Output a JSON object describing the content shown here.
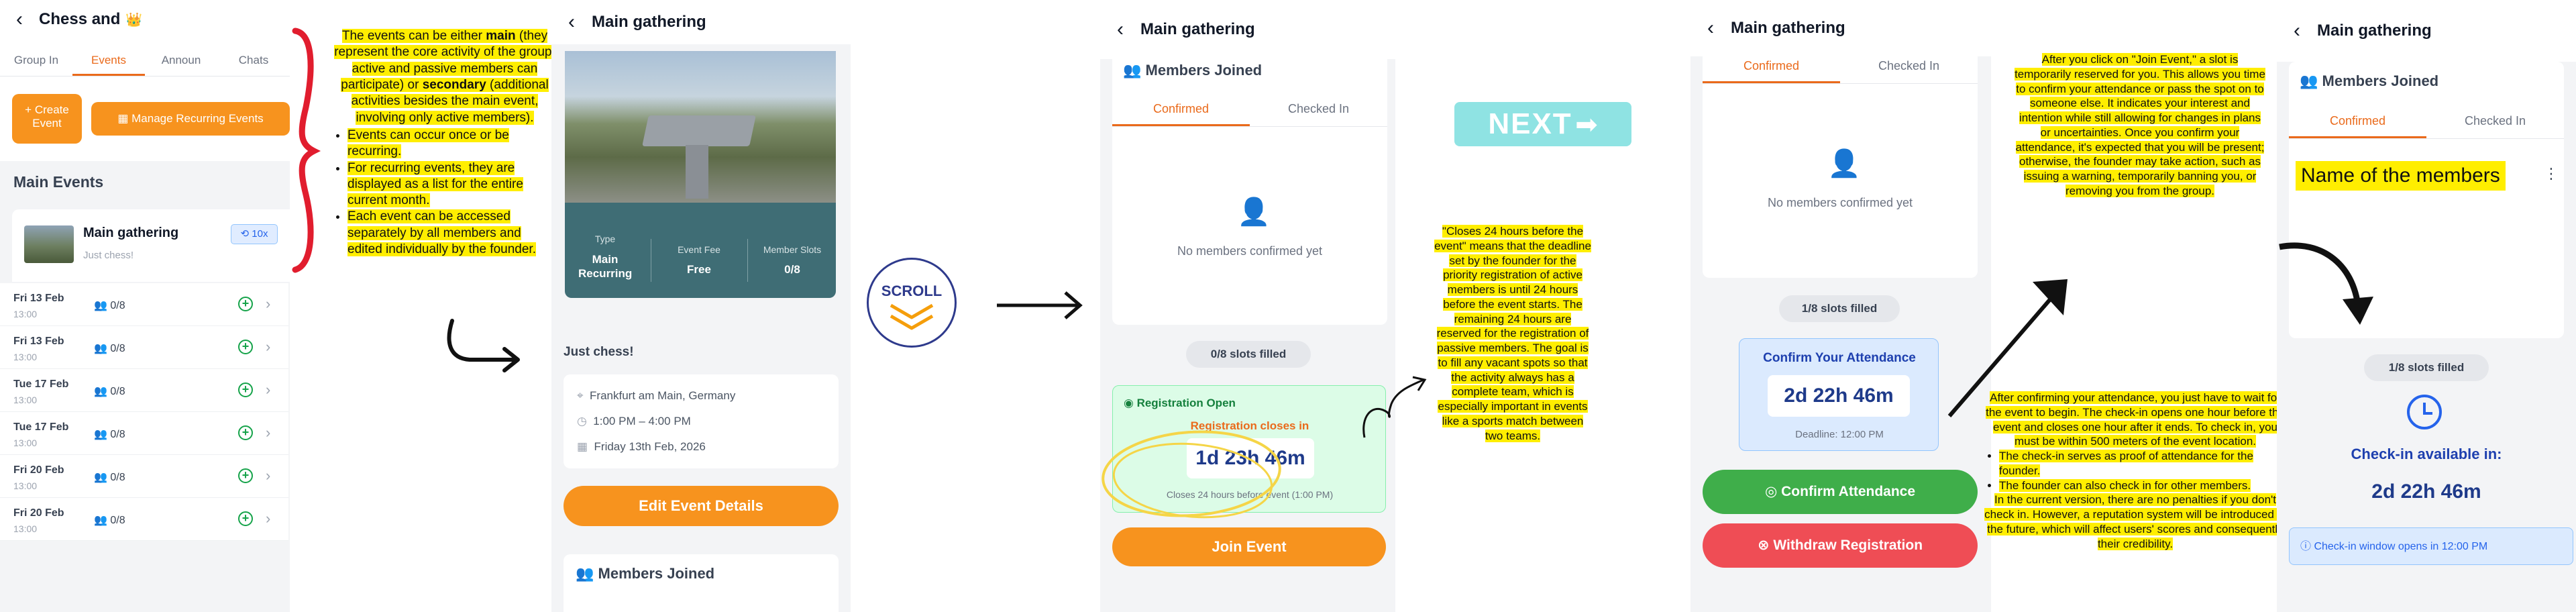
{
  "p1": {
    "title": "Chess and",
    "title_emoji": "👑",
    "tabs": [
      "Group In",
      "Events",
      "Announ",
      "Chats"
    ],
    "create_label": "Create Event",
    "manage_label": "Manage Recurring Events",
    "section": "Main Events",
    "event_name": "Main gathering",
    "event_sub": "Just chess!",
    "badge": "10x",
    "rows": [
      {
        "date": "Fri 13 Feb",
        "time": "13:00",
        "members": "0/8"
      },
      {
        "date": "Fri 13 Feb",
        "time": "13:00",
        "members": "0/8"
      },
      {
        "date": "Tue 17 Feb",
        "time": "13:00",
        "members": "0/8"
      },
      {
        "date": "Tue 17 Feb",
        "time": "13:00",
        "members": "0/8"
      },
      {
        "date": "Fri 20 Feb",
        "time": "13:00",
        "members": "0/8"
      },
      {
        "date": "Fri 20 Feb",
        "time": "13:00",
        "members": "0/8"
      }
    ]
  },
  "note1": {
    "a": "The events can be either ",
    "main": "main",
    "b": " (they represent the core activity of the group; active and passive members can participate) or ",
    "secondary": "secondary",
    "c": " (additional activities besides the main event, involving only active members).",
    "bullets": [
      "Events can occur once or be recurring.",
      "For recurring events, they are displayed as a list for the entire current month.",
      "Each event can be accessed separately by all members and edited individually by the founder."
    ]
  },
  "p2": {
    "title": "Main gathering",
    "type_label": "Type",
    "type_value": "Main Recurring",
    "fee_label": "Event Fee",
    "fee_value": "Free",
    "slots_label": "Member Slots",
    "slots_value": "0/8",
    "desc": "Just chess!",
    "location": "Frankfurt am Main, Germany",
    "time": "1:00 PM – 4:00 PM",
    "date": "Friday 13th Feb, 2026",
    "edit_label": "Edit Event Details",
    "members_joined": "Members Joined"
  },
  "scroll_label": "SCROLL",
  "p3": {
    "title": "Main gathering",
    "members_joined": "Members Joined",
    "tab_confirmed": "Confirmed",
    "tab_checked": "Checked In",
    "empty": "No members confirmed yet",
    "slots": "0/8 slots filled",
    "reg_open": "Registration Open",
    "reg_closes": "Registration closes in",
    "countdown": "1d 23h 46m",
    "closes_note": "Closes 24 hours before event (1:00 PM)",
    "join_label": "Join Event"
  },
  "next_label": "NEXT",
  "note2": "\"Closes 24 hours before the event\" means that the deadline set by the founder for the priority registration of active members is until 24 hours before the event starts. The remaining 24 hours are reserved for the registration of passive members. The goal is to fill any vacant spots so that the activity always has a complete team, which is especially important in events like a sports match between two teams.",
  "p4": {
    "title": "Main gathering",
    "tab_confirmed": "Confirmed",
    "tab_checked": "Checked In",
    "empty": "No members confirmed yet",
    "slots": "1/8 slots filled",
    "confirm_title": "Confirm Your Attendance",
    "countdown": "2d 22h 46m",
    "deadline": "Deadline: 12:00 PM",
    "confirm_btn": "Confirm Attendance",
    "withdraw_btn": "Withdraw Registration"
  },
  "note3": "After you click on \"Join Event,\" a slot is temporarily reserved for you. This allows you time to confirm your attendance or pass the spot on to someone else. It indicates your interest and intention while still allowing for changes in plans or uncertainties. Once you confirm your attendance, it's expected that you will be present; otherwise, the founder may take action, such as issuing a warning, temporarily banning you, or removing you from the group.",
  "note4": {
    "intro": "After confirming your attendance, you just have to wait for the event to begin. The check-in opens one hour before the event and closes one hour after it ends. To check in, you must be within 500 meters of the event location.",
    "bullets": [
      "The check-in serves as proof of attendance for the founder.",
      "The founder can also check in for other members."
    ],
    "outro": "In the current version, there are no penalties if you don't check in. However, a reputation system will be introduced in the future, which will affect users' scores and consequently their credibility."
  },
  "p5": {
    "title": "Main gathering",
    "members_joined": "Members Joined",
    "tab_confirmed": "Confirmed",
    "tab_checked": "Checked In",
    "member_name": "Name of the members",
    "slots": "1/8 slots filled",
    "checkin_label": "Check-in available in:",
    "countdown": "2d 22h 46m",
    "window_note": "Check-in window opens in 12:00 PM"
  }
}
